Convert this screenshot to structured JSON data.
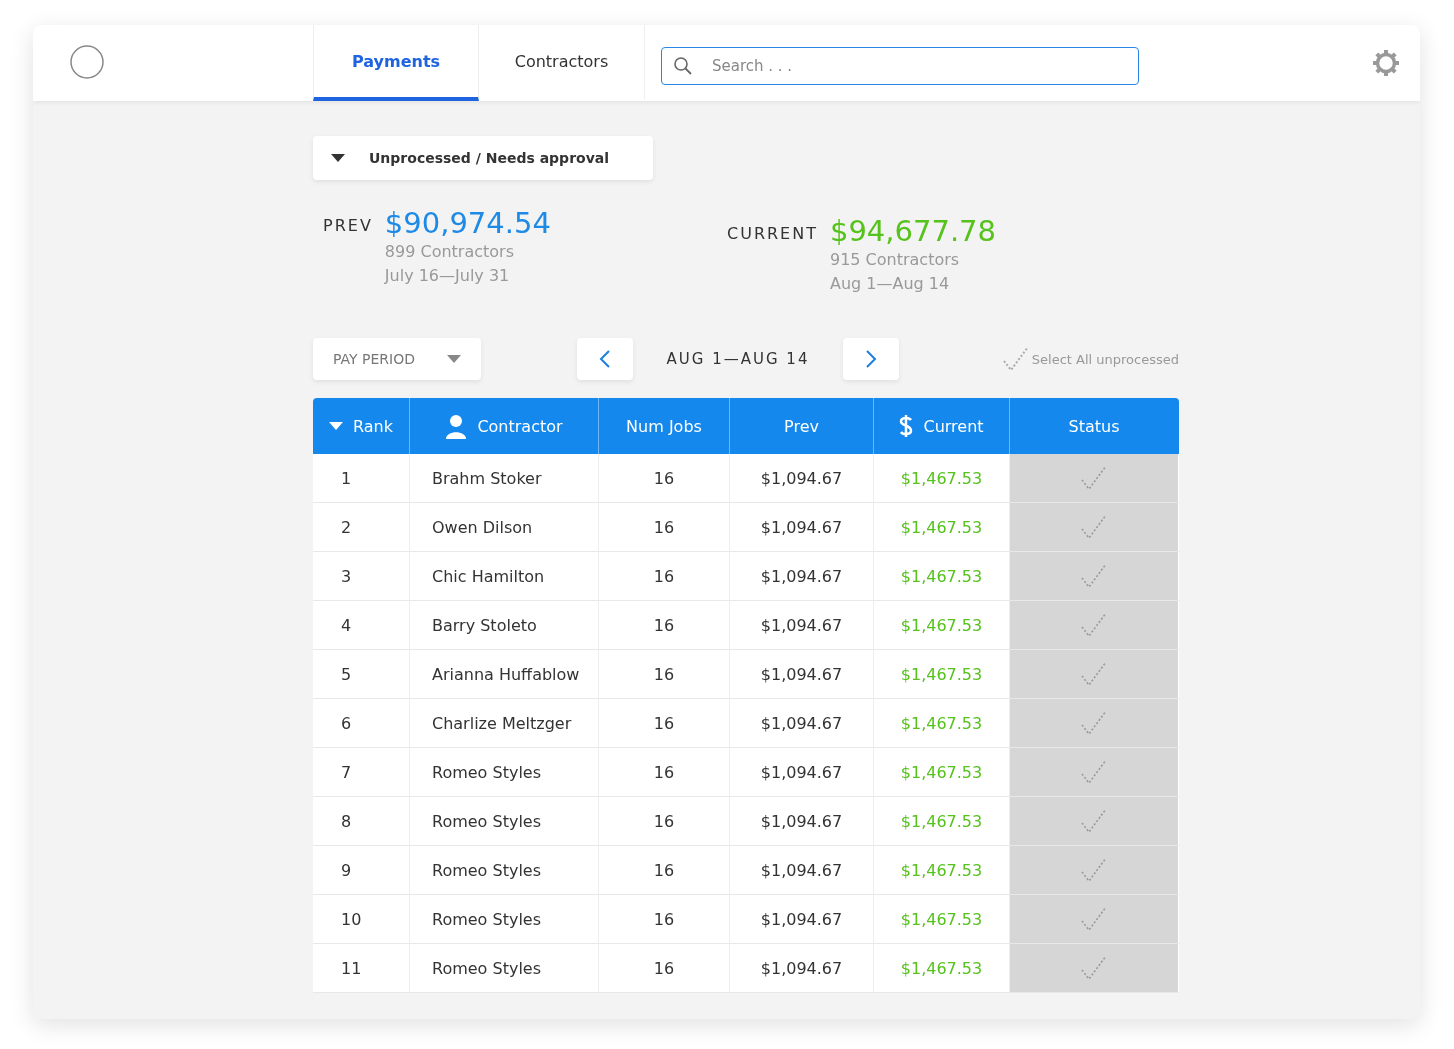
{
  "tabs": [
    {
      "label": "Payments",
      "selected": true
    },
    {
      "label": "Contractors",
      "selected": false
    }
  ],
  "search": {
    "placeholder": "Search . . ."
  },
  "filter": {
    "label": "Unprocessed / Needs approval"
  },
  "summary": [
    {
      "kind": "prev",
      "label": "PREV",
      "amount": "$90,974.54",
      "contractors": "899 Contractors",
      "range": "July 16—July 31"
    },
    {
      "kind": "current",
      "label": "CURRENT",
      "amount": "$94,677.78",
      "contractors": "915 Contractors",
      "range": "Aug 1—Aug 14"
    }
  ],
  "pay_period": {
    "label": "PAY PERIOD"
  },
  "period": {
    "label": "AUG 1—AUG 14"
  },
  "select_all": {
    "label": "Select All unprocessed",
    "checked": false
  },
  "table": {
    "columns": [
      {
        "label": "Rank",
        "kind": "sortable"
      },
      {
        "label": "Contractor",
        "kind": "person"
      },
      {
        "label": "Num Jobs",
        "kind": "plain"
      },
      {
        "label": "Prev",
        "kind": "plain"
      },
      {
        "label": "Current",
        "kind": "money"
      },
      {
        "label": "Status",
        "kind": "plain"
      }
    ],
    "rows": [
      {
        "rank": "1",
        "contractor": "Brahm Stoker",
        "jobs": "16",
        "prev": "$1,094.67",
        "current": "$1,467.53",
        "approved": false
      },
      {
        "rank": "2",
        "contractor": "Owen Dilson",
        "jobs": "16",
        "prev": "$1,094.67",
        "current": "$1,467.53",
        "approved": false
      },
      {
        "rank": "3",
        "contractor": "Chic Hamilton",
        "jobs": "16",
        "prev": "$1,094.67",
        "current": "$1,467.53",
        "approved": false
      },
      {
        "rank": "4",
        "contractor": "Barry Stoleto",
        "jobs": "16",
        "prev": "$1,094.67",
        "current": "$1,467.53",
        "approved": false
      },
      {
        "rank": "5",
        "contractor": "Arianna Huffablow",
        "jobs": "16",
        "prev": "$1,094.67",
        "current": "$1,467.53",
        "approved": false
      },
      {
        "rank": "6",
        "contractor": "Charlize Meltzger",
        "jobs": "16",
        "prev": "$1,094.67",
        "current": "$1,467.53",
        "approved": false
      },
      {
        "rank": "7",
        "contractor": "Romeo Styles",
        "jobs": "16",
        "prev": "$1,094.67",
        "current": "$1,467.53",
        "approved": false
      },
      {
        "rank": "8",
        "contractor": "Romeo Styles",
        "jobs": "16",
        "prev": "$1,094.67",
        "current": "$1,467.53",
        "approved": false
      },
      {
        "rank": "9",
        "contractor": "Romeo Styles",
        "jobs": "16",
        "prev": "$1,094.67",
        "current": "$1,467.53",
        "approved": false
      },
      {
        "rank": "10",
        "contractor": "Romeo Styles",
        "jobs": "16",
        "prev": "$1,094.67",
        "current": "$1,467.53",
        "approved": false
      },
      {
        "rank": "11",
        "contractor": "Romeo Styles",
        "jobs": "16",
        "prev": "$1,094.67",
        "current": "$1,467.53",
        "approved": false
      }
    ]
  }
}
